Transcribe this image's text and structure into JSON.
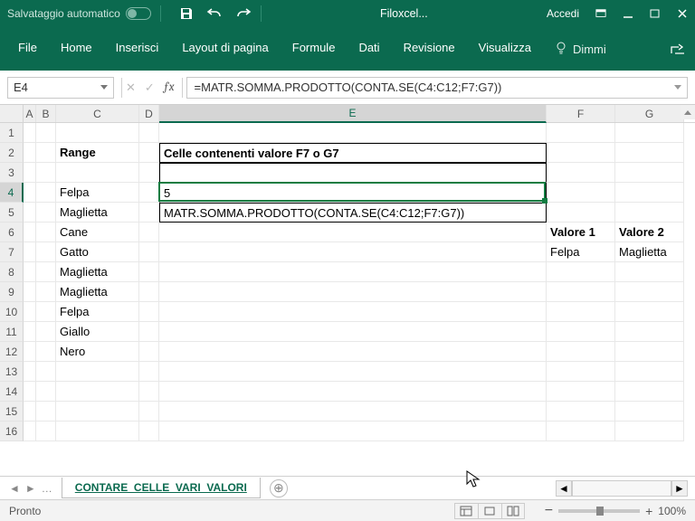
{
  "titlebar": {
    "autosave_label": "Salvataggio automatico",
    "filename": "Filoxcel...",
    "signin": "Accedi"
  },
  "ribbon": {
    "tabs": [
      "File",
      "Home",
      "Inserisci",
      "Layout di pagina",
      "Formule",
      "Dati",
      "Revisione",
      "Visualizza"
    ],
    "tell_me": "Dimmi"
  },
  "formula_bar": {
    "name_box": "E4",
    "formula": "=MATR.SOMMA.PRODOTTO(CONTA.SE(C4:C12;F7:G7))"
  },
  "columns": [
    "A",
    "B",
    "C",
    "D",
    "E",
    "F",
    "G"
  ],
  "rows_visible": 16,
  "selected_cell": {
    "row": 4,
    "col": "E"
  },
  "cells": {
    "C2": {
      "v": "Range",
      "bold": true
    },
    "E2": {
      "v": "Celle contenenti valore F7 o G7",
      "bold": true
    },
    "C4": {
      "v": "Felpa"
    },
    "E4": {
      "v": "5"
    },
    "C5": {
      "v": "Maglietta"
    },
    "E5": {
      "v": "MATR.SOMMA.PRODOTTO(CONTA.SE(C4:C12;F7:G7))"
    },
    "C6": {
      "v": "Cane"
    },
    "F6": {
      "v": "Valore 1",
      "bold": true
    },
    "G6": {
      "v": "Valore 2",
      "bold": true
    },
    "C7": {
      "v": "Gatto"
    },
    "F7": {
      "v": "Felpa"
    },
    "G7": {
      "v": "Maglietta"
    },
    "C8": {
      "v": "Maglietta"
    },
    "C9": {
      "v": "Maglietta"
    },
    "C10": {
      "v": "Felpa"
    },
    "C11": {
      "v": "Giallo"
    },
    "C12": {
      "v": "Nero"
    }
  },
  "sheet_tabs": {
    "active": "CONTARE_CELLE_VARI_VALORI"
  },
  "statusbar": {
    "status": "Pronto",
    "zoom": "100%"
  }
}
